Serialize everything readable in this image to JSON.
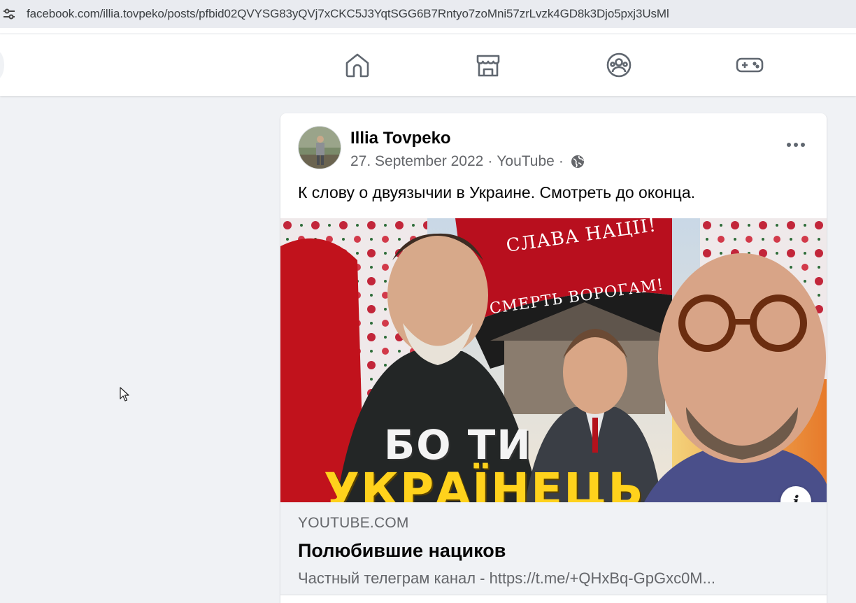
{
  "browser": {
    "url": "facebook.com/illia.tovpeko/posts/pfbid02QVYSG83yQVj7xCKC5J3YqtSGG6B7Rntyo7zoMni57zrLvzk4GD8k3Djo5pxj3UsMl",
    "site_info_icon": "tune-icon"
  },
  "nav": {
    "icons": [
      "home-icon",
      "marketplace-icon",
      "groups-icon",
      "gaming-icon"
    ]
  },
  "post": {
    "author": "Illia Tovpeko",
    "date": "27. September 2022",
    "source": "YouTube",
    "separator": "·",
    "privacy_icon": "globe-icon",
    "text": "К слову о двуязычии в Украине. Смотреть до оконца."
  },
  "thumbnail": {
    "banner_line1": "СЛАВА НАЦІЇ!",
    "banner_line2": "СМЕРТЬ ВОРОГАМ!",
    "caption_line1": "БО ТИ",
    "caption_line2": "УКРАЇНЕЦЬ",
    "info_label": "i"
  },
  "link_preview": {
    "domain": "YOUTUBE.COM",
    "title": "Полюбившие нациков",
    "description": "Частный телеграм канал - https://t.me/+QHxBq-GpGxc0M..."
  },
  "colors": {
    "page_bg": "#f0f2f5",
    "text_primary": "#050505",
    "text_secondary": "#65676b",
    "icon_gray": "#606770"
  }
}
